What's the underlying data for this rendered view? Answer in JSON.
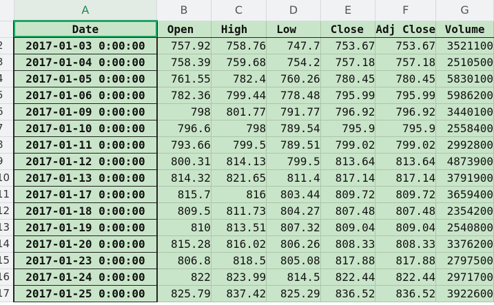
{
  "columns": [
    "A",
    "B",
    "C",
    "D",
    "E",
    "F",
    "G"
  ],
  "selected_column": "A",
  "header_row": {
    "row_number": "",
    "cells": [
      "Date",
      "Open",
      "High",
      "Low",
      "Close",
      "Adj Close",
      "Volume"
    ]
  },
  "rows": [
    {
      "n": "2",
      "cells": [
        "2017-01-03 0:00:00",
        "757.92",
        "758.76",
        "747.7",
        "753.67",
        "753.67",
        "3521100"
      ]
    },
    {
      "n": "3",
      "cells": [
        "2017-01-04 0:00:00",
        "758.39",
        "759.68",
        "754.2",
        "757.18",
        "757.18",
        "2510500"
      ]
    },
    {
      "n": "4",
      "cells": [
        "2017-01-05 0:00:00",
        "761.55",
        "782.4",
        "760.26",
        "780.45",
        "780.45",
        "5830100"
      ]
    },
    {
      "n": "5",
      "cells": [
        "2017-01-06 0:00:00",
        "782.36",
        "799.44",
        "778.48",
        "795.99",
        "795.99",
        "5986200"
      ]
    },
    {
      "n": "6",
      "cells": [
        "2017-01-09 0:00:00",
        "798",
        "801.77",
        "791.77",
        "796.92",
        "796.92",
        "3440100"
      ]
    },
    {
      "n": "7",
      "cells": [
        "2017-01-10 0:00:00",
        "796.6",
        "798",
        "789.54",
        "795.9",
        "795.9",
        "2558400"
      ]
    },
    {
      "n": "8",
      "cells": [
        "2017-01-11 0:00:00",
        "793.66",
        "799.5",
        "789.51",
        "799.02",
        "799.02",
        "2992800"
      ]
    },
    {
      "n": "9",
      "cells": [
        "2017-01-12 0:00:00",
        "800.31",
        "814.13",
        "799.5",
        "813.64",
        "813.64",
        "4873900"
      ]
    },
    {
      "n": "10",
      "cells": [
        "2017-01-13 0:00:00",
        "814.32",
        "821.65",
        "811.4",
        "817.14",
        "817.14",
        "3791900"
      ]
    },
    {
      "n": "11",
      "cells": [
        "2017-01-17 0:00:00",
        "815.7",
        "816",
        "803.44",
        "809.72",
        "809.72",
        "3659400"
      ]
    },
    {
      "n": "12",
      "cells": [
        "2017-01-18 0:00:00",
        "809.5",
        "811.73",
        "804.27",
        "807.48",
        "807.48",
        "2354200"
      ]
    },
    {
      "n": "13",
      "cells": [
        "2017-01-19 0:00:00",
        "810",
        "813.51",
        "807.32",
        "809.04",
        "809.04",
        "2540800"
      ]
    },
    {
      "n": "14",
      "cells": [
        "2017-01-20 0:00:00",
        "815.28",
        "816.02",
        "806.26",
        "808.33",
        "808.33",
        "3376200"
      ]
    },
    {
      "n": "15",
      "cells": [
        "2017-01-23 0:00:00",
        "806.8",
        "818.5",
        "805.08",
        "817.88",
        "817.88",
        "2797500"
      ]
    },
    {
      "n": "16",
      "cells": [
        "2017-01-24 0:00:00",
        "822",
        "823.99",
        "814.5",
        "822.44",
        "822.44",
        "2971700"
      ]
    },
    {
      "n": "17",
      "cells": [
        "2017-01-25 0:00:00",
        "825.79",
        "837.42",
        "825.29",
        "836.52",
        "836.52",
        "3922600"
      ]
    }
  ],
  "colors": {
    "cell_fill": "#c9e5c9",
    "header_fill": "#f1f2f4",
    "selection": "#21a366"
  }
}
